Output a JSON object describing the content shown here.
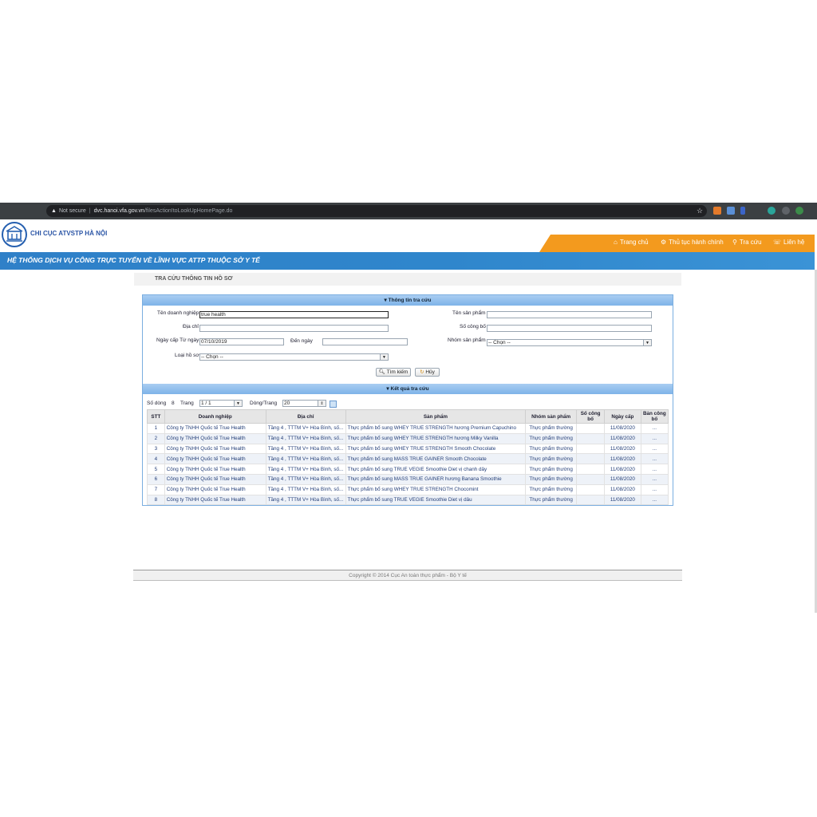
{
  "browser": {
    "security": "Not secure",
    "url_host": "dvc.hanoi.vfa.gov.vn",
    "url_path": "/filesAction!toLookUpHomePage.do"
  },
  "site": {
    "logo_text": "CHI CỤC ATVSTP HÀ NỘI",
    "nav": [
      "Trang chủ",
      "Thủ tục hành chính",
      "Tra cứu",
      "Liên hệ"
    ],
    "band_title": "HỆ THỐNG DỊCH VỤ CÔNG TRỰC TUYẾN VỀ LĨNH VỰC ATTP THUỘC SỞ Y TẾ",
    "page_title": "TRA CỨU THÔNG TIN HỒ SƠ"
  },
  "search": {
    "header": "Thông tin tra cứu",
    "ten_doanh_nghiep_label": "Tên doanh nghiệp",
    "ten_doanh_nghiep_value": "true health",
    "dia_chi_label": "Địa chỉ",
    "ngay_cap_label": "Ngày cấp Từ ngày",
    "tu_ngay_value": "07/10/2019",
    "den_ngay_label": "Đến ngày",
    "loai_ho_so_label": "Loại hồ sơ",
    "loai_ho_so_value": "-- Chọn --",
    "ten_san_pham_label": "Tên sản phẩm",
    "so_cong_bo_label": "Số công bố",
    "nhom_san_pham_label": "Nhóm sản phẩm",
    "nhom_san_pham_value": "-- Chọn --",
    "search_button": "Tìm kiếm",
    "cancel_button": "Hủy"
  },
  "results": {
    "header": "Kết quả tra cứu",
    "so_dong_label": "Số dòng",
    "so_dong_value": "8",
    "trang_label": "Trang",
    "trang_value": "1 / 1",
    "dong_trang_label": "Dòng/Trang",
    "dong_trang_value": "20",
    "columns": [
      "STT",
      "Doanh nghiệp",
      "Địa chỉ",
      "Sản phẩm",
      "Nhóm sản phẩm",
      "Số công bố",
      "Ngày cấp",
      "Bản công bố"
    ],
    "rows": [
      [
        "1",
        "Công ty TNHH Quốc tế True Health",
        "Tầng 4 , TTTM V+ Hòa Bình, số...",
        "Thực phẩm bổ sung WHEY TRUE STRENGTH hương Premium Capuchino",
        "Thực phẩm thường",
        "",
        "11/08/2020",
        "..."
      ],
      [
        "2",
        "Công ty TNHH Quốc tế True Health",
        "Tầng 4 , TTTM V+ Hòa Bình, số...",
        "Thực phẩm bổ sung WHEY TRUE STRENGTH hương Milky Vanilla",
        "Thực phẩm thường",
        "",
        "11/08/2020",
        "..."
      ],
      [
        "3",
        "Công ty TNHH Quốc tế True Health",
        "Tầng 4 , TTTM V+ Hòa Bình, số...",
        "Thực phẩm bổ sung WHEY TRUE STRENGTH Smooth Chocolate",
        "Thực phẩm thường",
        "",
        "11/08/2020",
        "..."
      ],
      [
        "4",
        "Công ty TNHH Quốc tế True Health",
        "Tầng 4 , TTTM V+ Hòa Bình, số...",
        "Thực phẩm bổ sung MASS TRUE GAINER Smooth Chocolate",
        "Thực phẩm thường",
        "",
        "11/08/2020",
        "..."
      ],
      [
        "5",
        "Công ty TNHH Quốc tế True Health",
        "Tầng 4 , TTTM V+ Hòa Bình, số...",
        "Thực phẩm bổ sung TRUE VEGIE Smoothie Diet vị chanh dây",
        "Thực phẩm thường",
        "",
        "11/08/2020",
        "..."
      ],
      [
        "6",
        "Công ty TNHH Quốc tế True Health",
        "Tầng 4 , TTTM V+ Hòa Bình, số...",
        "Thực phẩm bổ sung MASS TRUE GAINER hương Banana Smoothie",
        "Thực phẩm thường",
        "",
        "11/08/2020",
        "..."
      ],
      [
        "7",
        "Công ty TNHH Quốc tế True Health",
        "Tầng 4 , TTTM V+ Hòa Bình, số...",
        "Thực phẩm bổ sung WHEY TRUE STRENGTH Chocomint",
        "Thực phẩm thường",
        "",
        "11/08/2020",
        "..."
      ],
      [
        "8",
        "Công ty TNHH Quốc tế True Health",
        "Tầng 4 , TTTM V+ Hòa Bình, số...",
        "Thực phẩm bổ sung TRUE VEGIE Smoothie Diet vị dâu",
        "Thực phẩm thường",
        "",
        "11/08/2020",
        "..."
      ]
    ]
  },
  "footer": {
    "copyright": "Copyright © 2014 Cục An toàn thực phẩm - Bộ Y tế"
  },
  "colors": {
    "orange": "#f39a1e",
    "blue_band": "#2f80c8",
    "panel_border": "#7aaee0"
  }
}
